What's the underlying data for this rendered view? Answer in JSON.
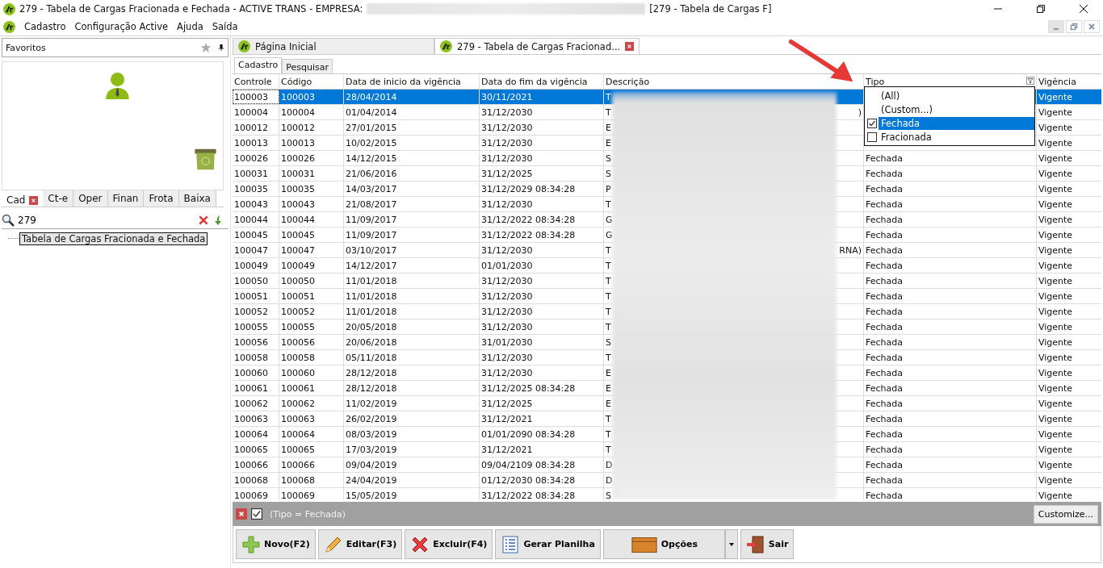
{
  "window": {
    "title": "279 - Tabela de Cargas Fracionada e Fechada - ACTIVE TRANS - EMPRESA:",
    "title_suffix": "[279 - Tabela de Cargas F]"
  },
  "menu": [
    "Cadastro",
    "Configuração Active",
    "Ajuda",
    "Saída"
  ],
  "sidebar": {
    "header": "Favoritos",
    "tabs": [
      {
        "label": "Cad",
        "selected": true,
        "closable": true
      },
      {
        "label": "Ct-e",
        "selected": false,
        "closable": false
      },
      {
        "label": "Oper",
        "selected": false,
        "closable": false
      },
      {
        "label": "Finan",
        "selected": false,
        "closable": false
      },
      {
        "label": "Frota",
        "selected": false,
        "closable": false
      },
      {
        "label": "Baixa",
        "selected": false,
        "closable": false
      }
    ],
    "search": {
      "value": "279"
    },
    "tree": [
      {
        "label": "Tabela de Cargas Fracionada e Fechada",
        "selected": true
      }
    ]
  },
  "doc_tabs": [
    {
      "label": "Página Inicial",
      "selected": false,
      "closable": false
    },
    {
      "label": "279 - Tabela de Cargas Fracionad...",
      "selected": true,
      "closable": true
    }
  ],
  "sub_tabs": [
    {
      "label": "Cadastro",
      "selected": true
    },
    {
      "label": "Pesquisar",
      "selected": false
    }
  ],
  "table": {
    "columns": [
      "Controle",
      "Código",
      "Data de inicio da vigência",
      "Data do fim da vigência",
      "Descrição",
      "Tipo",
      "Vigência"
    ],
    "rows": [
      {
        "controle": "100003",
        "codigo": "100003",
        "inicio": "28/04/2014",
        "fim": "30/11/2021",
        "descricao": "T",
        "vigencia": "Vigente",
        "selected": true
      },
      {
        "controle": "100004",
        "codigo": "100004",
        "inicio": "01/04/2014",
        "fim": "31/12/2030",
        "descricao": "T",
        "descricao_tail": ")",
        "vigencia": "Vigente",
        "selected": false
      },
      {
        "controle": "100012",
        "codigo": "100012",
        "inicio": "27/01/2015",
        "fim": "31/12/2030",
        "descricao": "E",
        "vigencia": "Vigente",
        "selected": false
      },
      {
        "controle": "100013",
        "codigo": "100013",
        "inicio": "10/02/2015",
        "fim": "31/12/2030",
        "descricao": "E",
        "vigencia": "Vigente",
        "selected": false
      },
      {
        "controle": "100026",
        "codigo": "100026",
        "inicio": "14/12/2015",
        "fim": "31/12/2030",
        "descricao": "S",
        "tipo": "Fechada",
        "vigencia": "Vigente",
        "selected": false
      },
      {
        "controle": "100031",
        "codigo": "100031",
        "inicio": "21/06/2016",
        "fim": "31/12/2025",
        "descricao": "S",
        "tipo": "Fechada",
        "vigencia": "Vigente",
        "selected": false
      },
      {
        "controle": "100035",
        "codigo": "100035",
        "inicio": "14/03/2017",
        "fim": "31/12/2029 08:34:28",
        "descricao": "P",
        "tipo": "Fechada",
        "vigencia": "Vigente",
        "selected": false
      },
      {
        "controle": "100043",
        "codigo": "100043",
        "inicio": "21/08/2017",
        "fim": "31/12/2030",
        "descricao": "T",
        "tipo": "Fechada",
        "vigencia": "Vigente",
        "selected": false
      },
      {
        "controle": "100044",
        "codigo": "100044",
        "inicio": "11/09/2017",
        "fim": "31/12/2022 08:34:28",
        "descricao": "G",
        "tipo": "Fechada",
        "vigencia": "Vigente",
        "selected": false
      },
      {
        "controle": "100045",
        "codigo": "100045",
        "inicio": "11/09/2017",
        "fim": "31/12/2022 08:34:28",
        "descricao": "G",
        "tipo": "Fechada",
        "vigencia": "Vigente",
        "selected": false
      },
      {
        "controle": "100047",
        "codigo": "100047",
        "inicio": "03/10/2017",
        "fim": "31/12/2030",
        "descricao": "T",
        "descricao_tail": "RNA)",
        "tipo": "Fechada",
        "vigencia": "Vigente",
        "selected": false
      },
      {
        "controle": "100049",
        "codigo": "100049",
        "inicio": "14/12/2017",
        "fim": "01/01/2030",
        "descricao": "T",
        "tipo": "Fechada",
        "vigencia": "Vigente",
        "selected": false
      },
      {
        "controle": "100050",
        "codigo": "100050",
        "inicio": "11/01/2018",
        "fim": "31/12/2030",
        "descricao": "T",
        "tipo": "Fechada",
        "vigencia": "Vigente",
        "selected": false
      },
      {
        "controle": "100051",
        "codigo": "100051",
        "inicio": "11/01/2018",
        "fim": "31/12/2030",
        "descricao": "T",
        "tipo": "Fechada",
        "vigencia": "Vigente",
        "selected": false
      },
      {
        "controle": "100052",
        "codigo": "100052",
        "inicio": "11/01/2018",
        "fim": "31/12/2030",
        "descricao": "T",
        "tipo": "Fechada",
        "vigencia": "Vigente",
        "selected": false
      },
      {
        "controle": "100055",
        "codigo": "100055",
        "inicio": "20/05/2018",
        "fim": "31/12/2030",
        "descricao": "T",
        "tipo": "Fechada",
        "vigencia": "Vigente",
        "selected": false
      },
      {
        "controle": "100056",
        "codigo": "100056",
        "inicio": "20/06/2018",
        "fim": "31/01/2030",
        "descricao": "S",
        "tipo": "Fechada",
        "vigencia": "Vigente",
        "selected": false
      },
      {
        "controle": "100058",
        "codigo": "100058",
        "inicio": "05/11/2018",
        "fim": "31/12/2030",
        "descricao": "T",
        "tipo": "Fechada",
        "vigencia": "Vigente",
        "selected": false
      },
      {
        "controle": "100060",
        "codigo": "100060",
        "inicio": "28/12/2018",
        "fim": "31/12/2030",
        "descricao": "E",
        "tipo": "Fechada",
        "vigencia": "Vigente",
        "selected": false
      },
      {
        "controle": "100061",
        "codigo": "100061",
        "inicio": "28/12/2018",
        "fim": "31/12/2025 08:34:28",
        "descricao": "E",
        "tipo": "Fechada",
        "vigencia": "Vigente",
        "selected": false
      },
      {
        "controle": "100062",
        "codigo": "100062",
        "inicio": "11/02/2019",
        "fim": "31/12/2025",
        "descricao": "E",
        "tipo": "Fechada",
        "vigencia": "Vigente",
        "selected": false
      },
      {
        "controle": "100063",
        "codigo": "100063",
        "inicio": "26/02/2019",
        "fim": "31/12/2021",
        "descricao": "T",
        "tipo": "Fechada",
        "vigencia": "Vigente",
        "selected": false
      },
      {
        "controle": "100064",
        "codigo": "100064",
        "inicio": "08/03/2019",
        "fim": "01/01/2090 08:34:28",
        "descricao": "T",
        "tipo": "Fechada",
        "vigencia": "Vigente",
        "selected": false
      },
      {
        "controle": "100065",
        "codigo": "100065",
        "inicio": "17/03/2019",
        "fim": "31/12/2021",
        "descricao": "T",
        "tipo": "Fechada",
        "vigencia": "Vigente",
        "selected": false
      },
      {
        "controle": "100066",
        "codigo": "100066",
        "inicio": "09/04/2019",
        "fim": "09/04/2109 08:34:28",
        "descricao": "D",
        "tipo": "Fechada",
        "vigencia": "Vigente",
        "selected": false
      },
      {
        "controle": "100068",
        "codigo": "100068",
        "inicio": "24/04/2019",
        "fim": "01/12/2030 08:34:28",
        "descricao": "D",
        "tipo": "Fechada",
        "vigencia": "Vigente",
        "selected": false
      },
      {
        "controle": "100069",
        "codigo": "100069",
        "inicio": "15/05/2019",
        "fim": "31/12/2022 08:34:28",
        "descricao": "S",
        "tipo": "Fechada",
        "vigencia": "Vigente",
        "selected": false
      }
    ]
  },
  "filter_dropdown": [
    {
      "label": "(All)",
      "kind": "option",
      "selected": false
    },
    {
      "label": "(Custom...)",
      "kind": "option",
      "selected": false
    },
    {
      "label": "Fechada",
      "kind": "checkbox",
      "checked": true,
      "selected": true
    },
    {
      "label": "Fracionada",
      "kind": "checkbox",
      "checked": false,
      "selected": false
    }
  ],
  "filter_bar": {
    "enabled": true,
    "expression": "(Tipo = Fechada)",
    "customize": "Customize..."
  },
  "buttons": [
    {
      "label": "Novo(F2)",
      "kind": "plus"
    },
    {
      "label": "Editar(F3)",
      "kind": "pencil"
    },
    {
      "label": "Excluir(F4)",
      "kind": "cross"
    },
    {
      "label": "Gerar Planilha",
      "kind": "list"
    },
    {
      "label": "Opções",
      "kind": "box",
      "dropdown": true
    },
    {
      "label": "Sair",
      "kind": "door"
    }
  ]
}
